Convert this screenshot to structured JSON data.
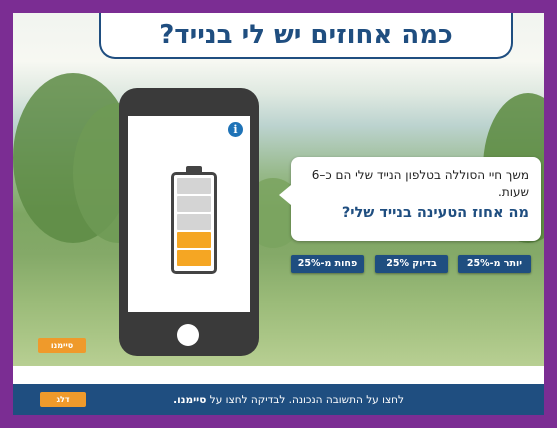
{
  "title": "כמה אחוזים יש לי בנייד?",
  "info_icon": "i",
  "question": {
    "context": "משך חיי הסוללה בטלפון הנייד שלי הם כ–6 שעות.",
    "prompt": "מה אחוז הטעינה בנייד שלי?"
  },
  "answers": [
    {
      "label": "יותר מ-25%"
    },
    {
      "label": "בדיוק 25%"
    },
    {
      "label": "פחות מ-25%"
    }
  ],
  "buttons": {
    "check_label": "סיימנו",
    "skip_label": "דלג"
  },
  "instruction_prefix": "לחצו על התשובה הנכונה. לבדיקה לחצו על ",
  "instruction_bold": "סיימנו.",
  "battery": {
    "segments_total": 5,
    "segments_filled": 2,
    "fill_color": "#f5a623",
    "empty_color": "#d4d4d4"
  },
  "colors": {
    "frame": "#7b2d93",
    "primary": "#1f4e80",
    "accent": "#ef9a2b"
  }
}
